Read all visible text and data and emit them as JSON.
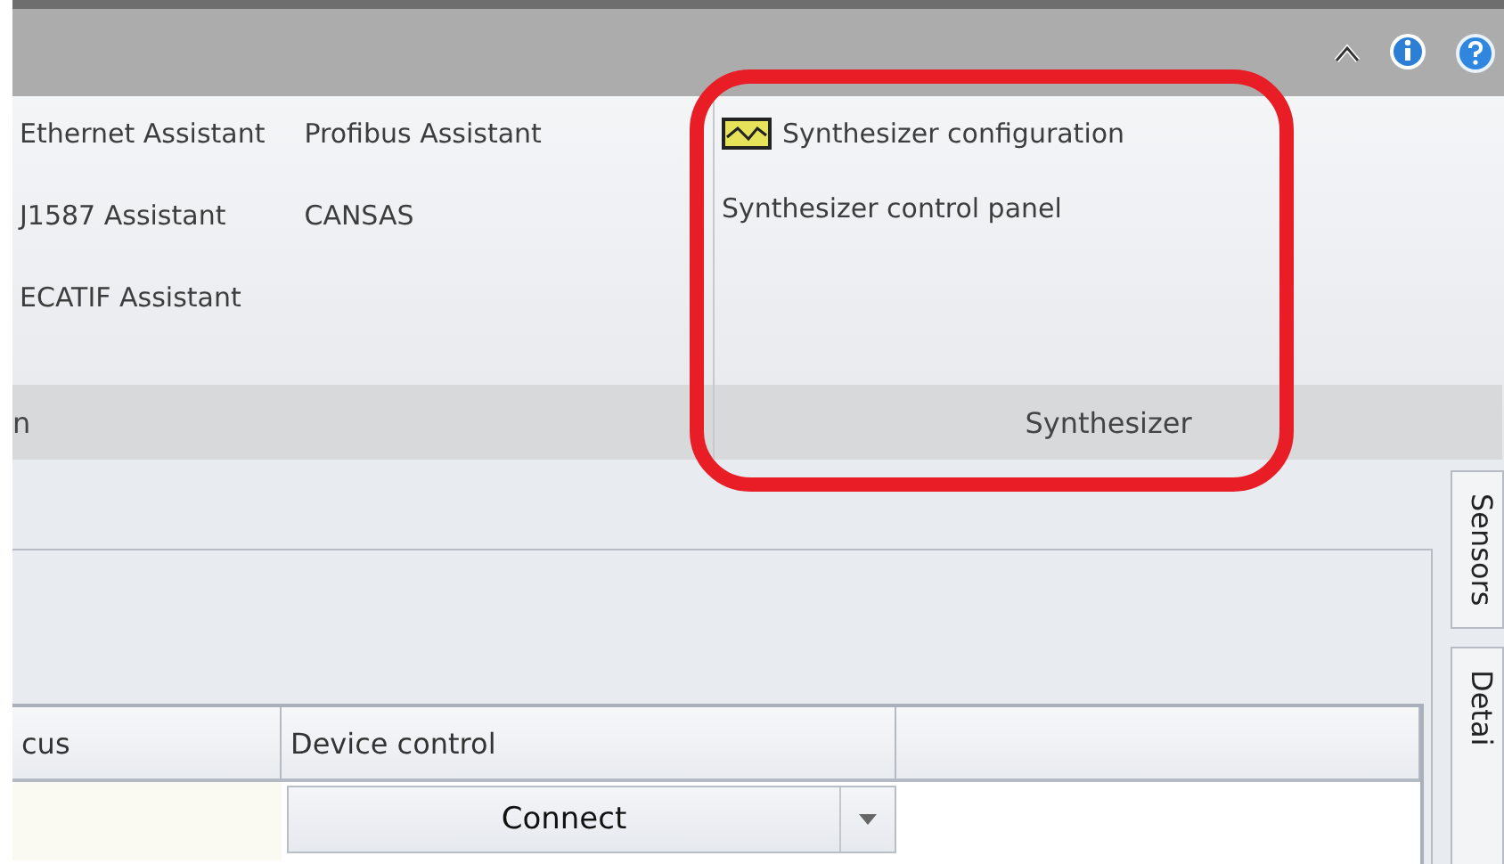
{
  "ribbon": {
    "groups": [
      {
        "label": "n",
        "columns": [
          [
            {
              "label": "Ethernet Assistant",
              "kind": "text"
            },
            {
              "label": "J1587 Assistant",
              "kind": "text"
            },
            {
              "label": "ECATIF Assistant",
              "kind": "text"
            }
          ],
          [
            {
              "label": "Profibus Assistant",
              "kind": "text"
            },
            {
              "label": "CANSAS",
              "kind": "text"
            }
          ]
        ]
      },
      {
        "label": "Synthesizer",
        "columns": [
          [
            {
              "label": "Synthesizer configuration",
              "kind": "icon"
            },
            {
              "label": "Synthesizer control panel",
              "kind": "text"
            }
          ]
        ]
      }
    ]
  },
  "side_tabs": [
    "Sensors",
    "Detai"
  ],
  "table": {
    "columns": [
      "cus",
      "Device control"
    ],
    "rows": [
      {
        "device_control": "Connect"
      }
    ]
  }
}
